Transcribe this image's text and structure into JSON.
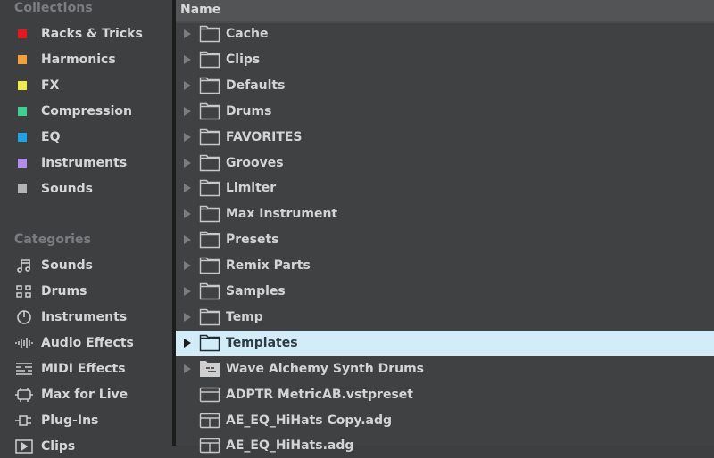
{
  "sidebar": {
    "collections_title": "Collections",
    "collections": [
      {
        "label": "Racks & Tricks",
        "color": "#e8161e"
      },
      {
        "label": "Harmonics",
        "color": "#f2a03c"
      },
      {
        "label": "FX",
        "color": "#f2e94a"
      },
      {
        "label": "Compression",
        "color": "#3ed08e"
      },
      {
        "label": "EQ",
        "color": "#1ea3e6"
      },
      {
        "label": "Instruments",
        "color": "#b38cf0"
      },
      {
        "label": "Sounds",
        "color": "#b4b4b4"
      }
    ],
    "categories_title": "Categories",
    "categories": [
      {
        "label": "Sounds",
        "icon": "music-note-icon"
      },
      {
        "label": "Drums",
        "icon": "drum-grid-icon"
      },
      {
        "label": "Instruments",
        "icon": "power-knob-icon"
      },
      {
        "label": "Audio Effects",
        "icon": "waveform-icon"
      },
      {
        "label": "MIDI Effects",
        "icon": "midi-lines-icon"
      },
      {
        "label": "Max for Live",
        "icon": "max-device-icon"
      },
      {
        "label": "Plug-Ins",
        "icon": "plug-icon"
      },
      {
        "label": "Clips",
        "icon": "clip-play-icon"
      }
    ]
  },
  "browser": {
    "column_header": "Name",
    "selected_index": 12,
    "rows": [
      {
        "label": "Cache",
        "type": "folder"
      },
      {
        "label": "Clips",
        "type": "folder"
      },
      {
        "label": "Defaults",
        "type": "folder"
      },
      {
        "label": "Drums",
        "type": "folder"
      },
      {
        "label": "FAVORITES",
        "type": "folder"
      },
      {
        "label": "Grooves",
        "type": "folder"
      },
      {
        "label": "Limiter",
        "type": "folder"
      },
      {
        "label": "Max Instrument",
        "type": "folder"
      },
      {
        "label": "Presets",
        "type": "folder"
      },
      {
        "label": "Remix Parts",
        "type": "folder"
      },
      {
        "label": "Samples",
        "type": "folder"
      },
      {
        "label": "Temp",
        "type": "folder"
      },
      {
        "label": "Templates",
        "type": "folder"
      },
      {
        "label": "Wave Alchemy Synth Drums",
        "type": "pack"
      },
      {
        "label": "ADPTR MetricAB.vstpreset",
        "type": "preset"
      },
      {
        "label": "AE_EQ_HiHats Copy.adg",
        "type": "rack"
      },
      {
        "label": "AE_EQ_HiHats.adg",
        "type": "rack"
      }
    ]
  }
}
